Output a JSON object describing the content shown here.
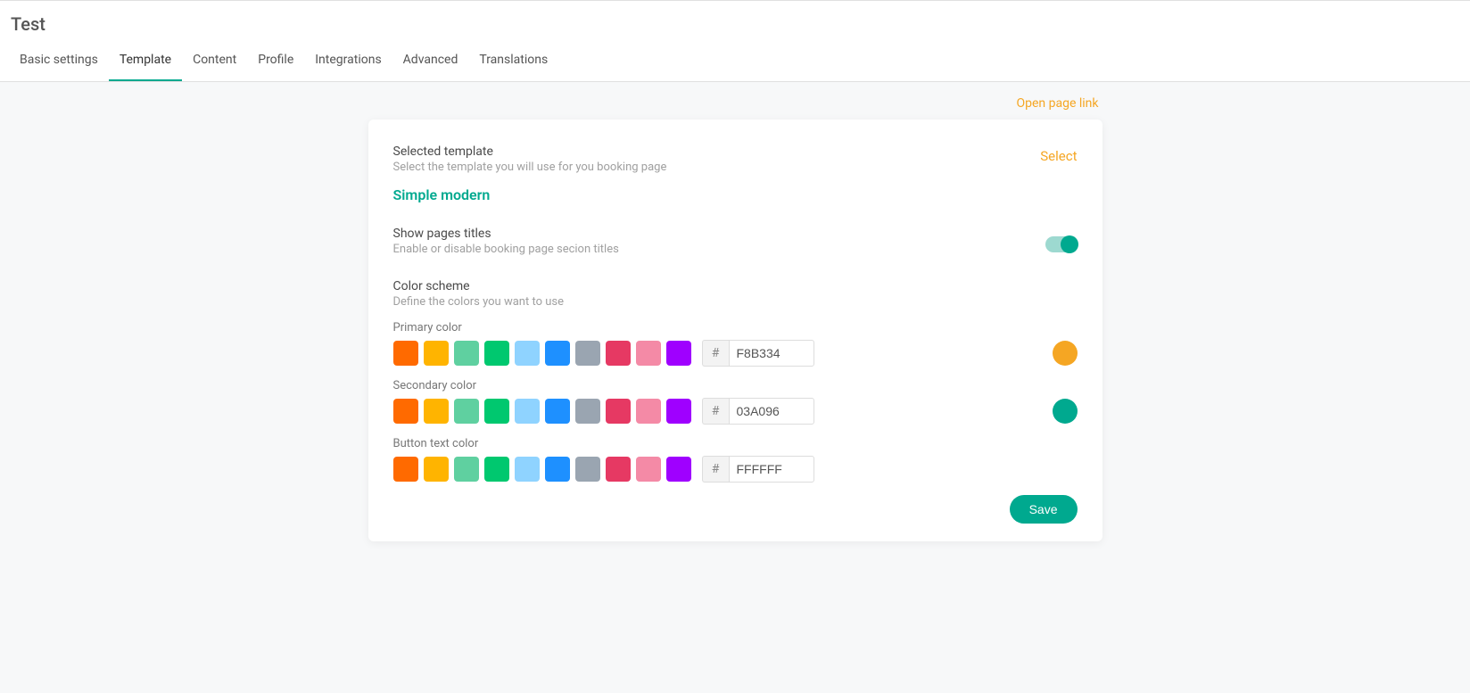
{
  "page_title": "Test",
  "tabs": [
    "Basic settings",
    "Template",
    "Content",
    "Profile",
    "Integrations",
    "Advanced",
    "Translations"
  ],
  "active_tab_index": 1,
  "open_page_link": "Open page link",
  "template_section": {
    "title": "Selected template",
    "subtitle": "Select the template you will use for you booking page",
    "select_label": "Select",
    "selected_name": "Simple modern"
  },
  "titles_section": {
    "title": "Show pages titles",
    "subtitle": "Enable or disable booking page secion titles",
    "enabled": true
  },
  "colors_section": {
    "title": "Color scheme",
    "subtitle": "Define the colors you want to use"
  },
  "palette": [
    "#ff6a00",
    "#ffb400",
    "#5fd0a0",
    "#00c86f",
    "#8fd3ff",
    "#1e90ff",
    "#9aa5b1",
    "#e63963",
    "#f48aa6",
    "#9f00ff"
  ],
  "primary": {
    "label": "Primary color",
    "hex": "F8B334",
    "preview": "#f5a623"
  },
  "secondary": {
    "label": "Secondary color",
    "hex": "03A096",
    "preview": "#00a98f"
  },
  "button_text": {
    "label": "Button text color",
    "hex": "FFFFFF",
    "preview": "#ffffff"
  },
  "hash": "#",
  "save_label": "Save"
}
